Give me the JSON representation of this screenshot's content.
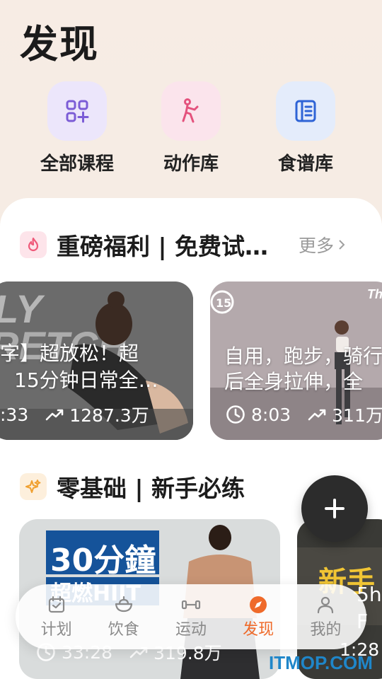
{
  "page": {
    "title": "发现"
  },
  "quick_links": [
    {
      "label": "全部课程",
      "icon": "grid-plus-icon",
      "color": "#7b5cd6",
      "bg": "#ece6fb"
    },
    {
      "label": "动作库",
      "icon": "stretch-figure-icon",
      "color": "#e4527d",
      "bg": "#fbe4ec"
    },
    {
      "label": "食谱库",
      "icon": "book-icon",
      "color": "#2f64d6",
      "bg": "#e4ecfb"
    }
  ],
  "section1": {
    "title": "重磅福利 | 免费试…",
    "more": "更多",
    "cards": [
      {
        "overlay": "LY\nRETCH",
        "line1": "字】超放松！超",
        "line2": "15分钟日常全…",
        "duration": ":33",
        "views": "1287.3万"
      },
      {
        "badge": "15",
        "corner": "Th",
        "line1": "自用，跑步，骑行",
        "line2": "后全身拉伸，全",
        "duration": "8:03",
        "views": "311万"
      }
    ]
  },
  "section2": {
    "title": "零基础 | 新手必练",
    "cards": [
      {
        "banner": "30分鐘",
        "banner2": "超燃HIIT",
        "duration": "33:28",
        "views": "319.8万"
      },
      {
        "banner": "新手",
        "line1": "5h",
        "line2": "F",
        "duration": "1:28"
      }
    ]
  },
  "fab": {
    "icon": "plus-icon"
  },
  "tabbar": [
    {
      "label": "计划",
      "icon": "calendar-check-icon",
      "active": false
    },
    {
      "label": "饮食",
      "icon": "bowl-icon",
      "active": false
    },
    {
      "label": "运动",
      "icon": "dumbbell-icon",
      "active": false
    },
    {
      "label": "发现",
      "icon": "compass-icon",
      "active": true
    },
    {
      "label": "我的",
      "icon": "person-icon",
      "active": false
    }
  ],
  "watermark": "ITMOP.COM",
  "colors": {
    "accent": "#ef6a2a",
    "background": "#f5ece4"
  }
}
